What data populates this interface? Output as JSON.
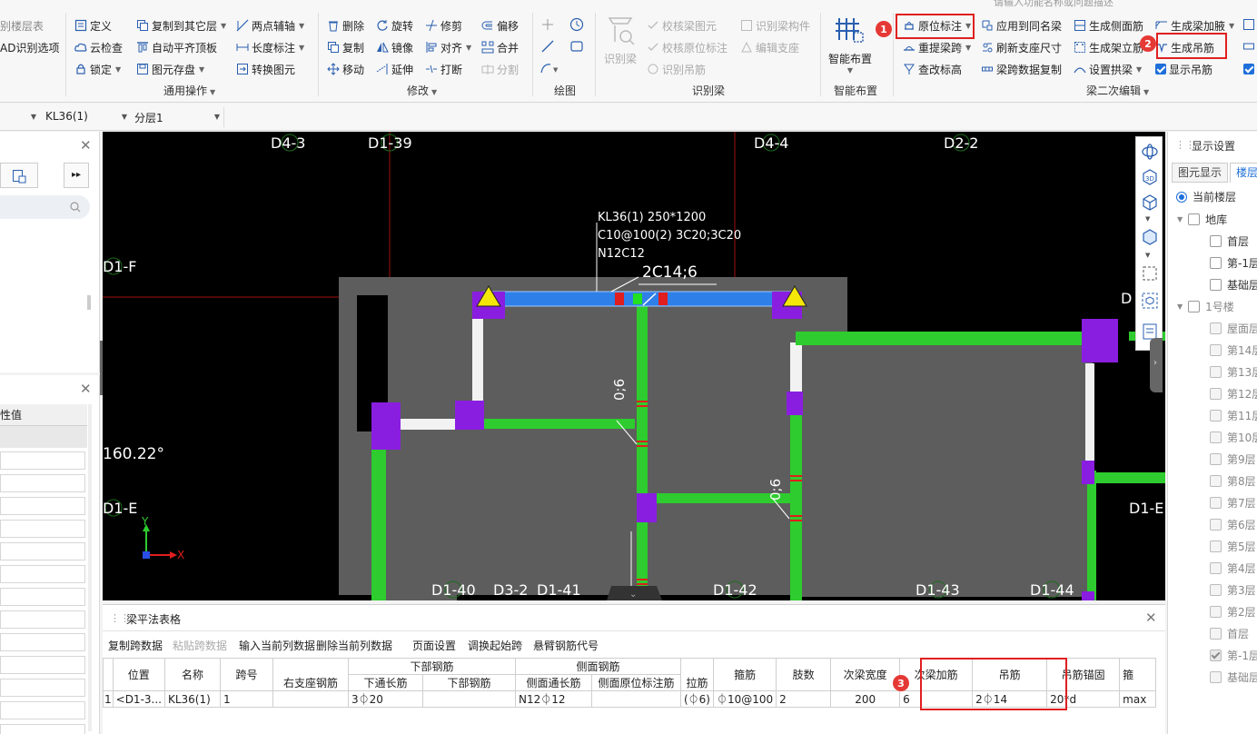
{
  "ribbon": {
    "partial_left_top": "别楼层表",
    "partial_left_mid": "AD识别选项",
    "col1": {
      "define": "定义",
      "cloud_check": "云检查",
      "lock": "锁定"
    },
    "col2": {
      "copy_floor": "复制到其它层",
      "auto_align": "自动平齐顶板",
      "save_elem": "图元存盘"
    },
    "col3": {
      "two_point_axis": "两点辅轴",
      "length_dim": "长度标注",
      "convert_elem": "转换图元"
    },
    "group_general": "通用操作",
    "modify": {
      "delete": "删除",
      "rotate": "旋转",
      "trim": "修剪",
      "offset": "偏移",
      "copy": "复制",
      "mirror": "镜像",
      "align": "对齐",
      "merge": "合并",
      "move": "移动",
      "extend": "延伸",
      "break": "打断",
      "split": "分割"
    },
    "group_modify": "修改",
    "group_draw": "绘图",
    "identify": {
      "identify_beam": "识别梁",
      "check_beam": "校核梁图元",
      "check_origin": "校核原位标注",
      "identify_hanger": "识别吊筋",
      "identify_member": "识别梁构件",
      "edit_support": "编辑支座"
    },
    "group_identify": "识别梁",
    "smart_layout": "智能布置",
    "group_smart": "智能布置",
    "edit2": {
      "in_situ": "原位标注",
      "re_span": "重提梁跨",
      "check_elev": "查改标高",
      "apply_same": "应用到同名梁",
      "refresh_support": "刷新支座尺寸",
      "span_copy": "梁跨数据复制",
      "gen_side": "生成侧面筋",
      "gen_erect": "生成架立筋",
      "set_arch": "设置拱梁",
      "gen_haunch": "生成梁加腋",
      "gen_hanger": "生成吊筋",
      "show_hanger": "显示吊筋"
    },
    "group_edit2": "梁二次编辑",
    "search_placeholder": "请输入功能名称或问题描述"
  },
  "badges": {
    "b1": "1",
    "b2": "2",
    "b3": "3"
  },
  "selector": {
    "beam": "KL36(1)",
    "layer": "分层1"
  },
  "canvas": {
    "axes": [
      "D4-3",
      "D1-39",
      "D4-4",
      "D2-2",
      "D1-F",
      "D1-E",
      "D1-E",
      "D1-40",
      "D3-2",
      "D1-41",
      "D1-42",
      "D1-43",
      "D1-44",
      "D"
    ],
    "annotation_line1": "KL36(1) 250*1200",
    "annotation_line2": "C10@100(2) 3C20;3C20",
    "annotation_line3": "N12C12",
    "hanger_label": "2C14;6",
    "angle": "160.22°",
    "rebar_label_1": "0;6",
    "rebar_label_2": "0;6",
    "coord_y": "Y",
    "coord_x": "X"
  },
  "left_panel": {
    "attr_value_header": "性值"
  },
  "right_panel": {
    "title": "显示设置",
    "tab_elem": "图元显示",
    "tab_floor": "楼层",
    "current_floor": "当前楼层",
    "tree": [
      {
        "label": "地库",
        "level": 0
      },
      {
        "label": "首层",
        "level": 1
      },
      {
        "label": "第-1层",
        "level": 1
      },
      {
        "label": "基础层",
        "level": 1
      },
      {
        "label": "1号楼",
        "level": 0
      },
      {
        "label": "屋面层",
        "level": 1
      },
      {
        "label": "第14层",
        "level": 1
      },
      {
        "label": "第13层",
        "level": 1
      },
      {
        "label": "第12层",
        "level": 1
      },
      {
        "label": "第11层",
        "level": 1
      },
      {
        "label": "第10层",
        "level": 1
      },
      {
        "label": "第9层",
        "level": 1
      },
      {
        "label": "第8层",
        "level": 1
      },
      {
        "label": "第7层",
        "level": 1
      },
      {
        "label": "第6层",
        "level": 1
      },
      {
        "label": "第5层",
        "level": 1
      },
      {
        "label": "第4层",
        "level": 1
      },
      {
        "label": "第3层",
        "level": 1
      },
      {
        "label": "第2层",
        "level": 1
      },
      {
        "label": "首层",
        "level": 1
      },
      {
        "label": "第-1层",
        "level": 1
      },
      {
        "label": "基础层",
        "level": 1
      }
    ]
  },
  "bottom": {
    "title": "梁平法表格",
    "toolbar": [
      "复制跨数据",
      "粘贴跨数据",
      "输入当前列数据",
      "删除当前列数据",
      "页面设置",
      "调换起始跨",
      "悬臂钢筋代号"
    ],
    "headers": {
      "position": "位置",
      "name": "名称",
      "span": "跨号",
      "bottom_group": "下部钢筋",
      "side_group": "侧面钢筋",
      "right_support": "右支座钢筋",
      "bottom_through": "下通长筋",
      "bottom_bar": "下部钢筋",
      "side_through": "侧面通长筋",
      "side_origin": "侧面原位标注筋",
      "tie": "拉筋",
      "stirrup": "箍筋",
      "legs": "肢数",
      "sec_width": "次梁宽度",
      "sec_add": "次梁加筋",
      "hanger": "吊筋",
      "hanger_anchor": "吊筋锚固",
      "more": "箍"
    },
    "row": {
      "idx": "1",
      "position": "<D1-3...",
      "name": "KL36(1)",
      "span": "1",
      "right_support": "",
      "bottom_through": "3⏀20",
      "bottom_bar": "",
      "side_through": "N12⏀12",
      "side_origin": "",
      "tie": "(⏀6)",
      "stirrup": "⏀10@100",
      "legs": "2",
      "sec_width": "200",
      "sec_add": "6",
      "hanger": "2⏀14",
      "hanger_anchor": "20*d",
      "more": "max"
    }
  },
  "colors": {
    "beam_green": "#2ecc2e",
    "beam_blue": "#2f7fe8",
    "column_purple": "#8a1ee0",
    "slab_gray": "#5d5d5d",
    "highlight_red": "#e02020"
  }
}
